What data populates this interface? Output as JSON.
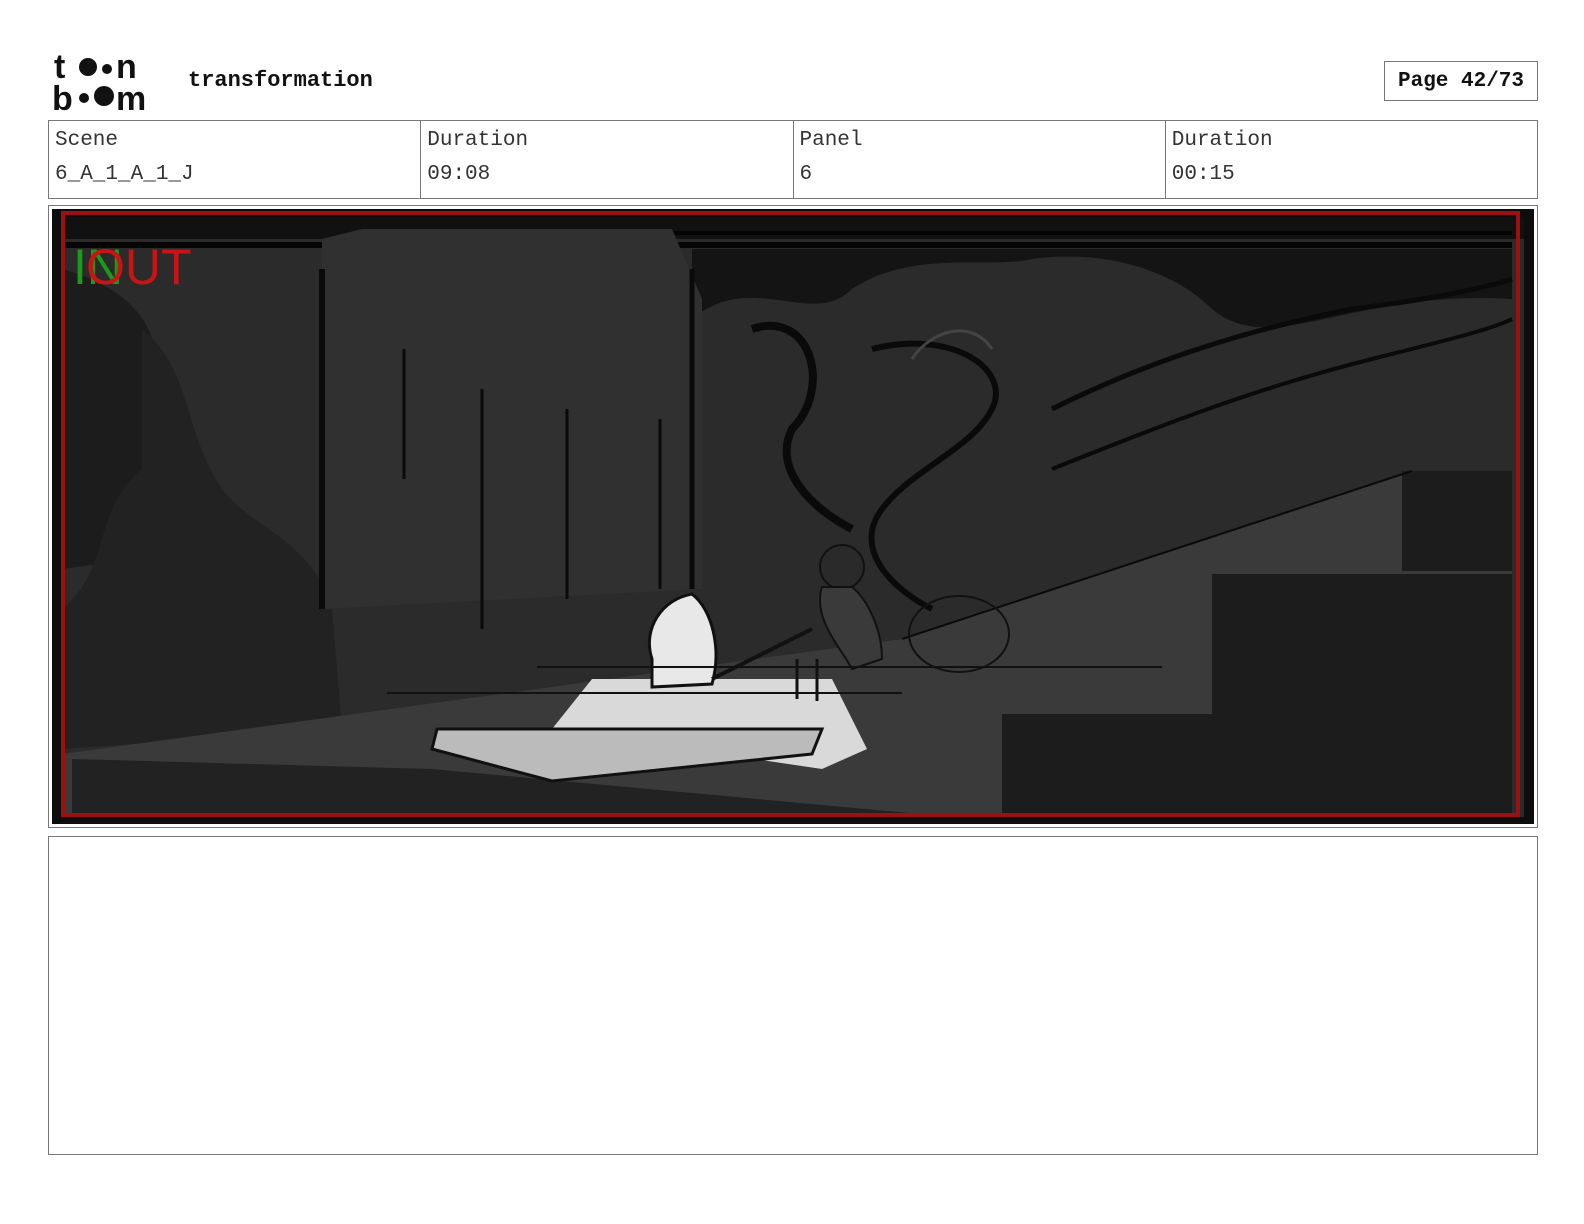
{
  "header": {
    "logo_text": "toon boom",
    "title": "transformation",
    "page_label": "Page 42/73"
  },
  "info": {
    "scene_label": "Scene",
    "scene_value": "6_A_1_A_1_J",
    "duration_label": "Duration",
    "duration_value": "09:08",
    "panel_label": "Panel",
    "panel_value": "6",
    "panel_duration_label": "Duration",
    "panel_duration_value": "00:15"
  },
  "panel": {
    "overlay_in": "IN",
    "overlay_out": "OUT",
    "overlay_in_color": "#1a9c1a",
    "overlay_out_color": "#c81414",
    "safe_frame_color": "#9b1010"
  },
  "notes": {
    "text": ""
  }
}
